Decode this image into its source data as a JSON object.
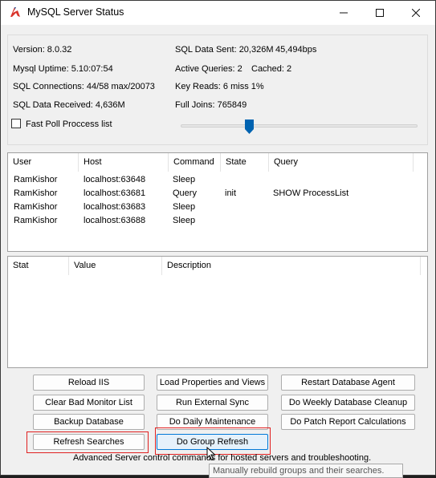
{
  "window": {
    "title": "MySQL Server Status",
    "icons": {
      "app": "mysql-dolphin-icon",
      "minimize": "minimize-icon",
      "maximize": "maximize-icon",
      "close": "close-icon"
    }
  },
  "info": {
    "version": "Version: 8.0.32",
    "uptime": "Mysql Uptime: 5.10:07:54",
    "connections": "SQL Connections: 44/58 max/20073",
    "received": "SQL Data Received: 4,636M",
    "sent": "SQL Data Sent: 20,326M",
    "sent_rate": "45,494bps",
    "active_queries": "Active Queries: 2",
    "cached": "Cached: 2",
    "key_reads": "Key Reads: 6 miss 1%",
    "full_joins": "Full Joins: 765849",
    "fast_poll_label": "Fast Poll Proccess list",
    "fast_poll_checked": false,
    "poll_slider_fraction": 0.29
  },
  "process_list": {
    "columns": [
      "User",
      "Host",
      "Command",
      "State",
      "Query"
    ],
    "rows": [
      [
        "RamKishor",
        "localhost:63648",
        "Sleep",
        "",
        ""
      ],
      [
        "RamKishor",
        "localhost:63681",
        "Query",
        "init",
        "SHOW ProcessList"
      ],
      [
        "RamKishor",
        "localhost:63683",
        "Sleep",
        "",
        ""
      ],
      [
        "RamKishor",
        "localhost:63688",
        "Sleep",
        "",
        ""
      ]
    ]
  },
  "stats": {
    "columns": [
      "Stat",
      "Value",
      "Description"
    ]
  },
  "buttons": {
    "reload_iis": "Reload IIS",
    "load_properties": "Load Properties and Views",
    "restart_agent": "Restart Database Agent",
    "clear_bad_monitor": "Clear Bad Monitor List",
    "run_external_sync": "Run External Sync",
    "weekly_cleanup": "Do Weekly Database Cleanup",
    "backup_database": "Backup Database",
    "daily_maintenance": "Do Daily Maintenance",
    "patch_report": "Do Patch Report Calculations",
    "refresh_searches": "Refresh Searches",
    "group_refresh": "Do Group Refresh"
  },
  "status_text": "Advanced Server control commands for hosted servers and troubleshooting.",
  "tooltip": "Manually rebuild groups and their searches.",
  "colors": {
    "accent": "#0078d7",
    "highlight_frame": "#e02020",
    "slider_thumb": "#0063b1"
  }
}
